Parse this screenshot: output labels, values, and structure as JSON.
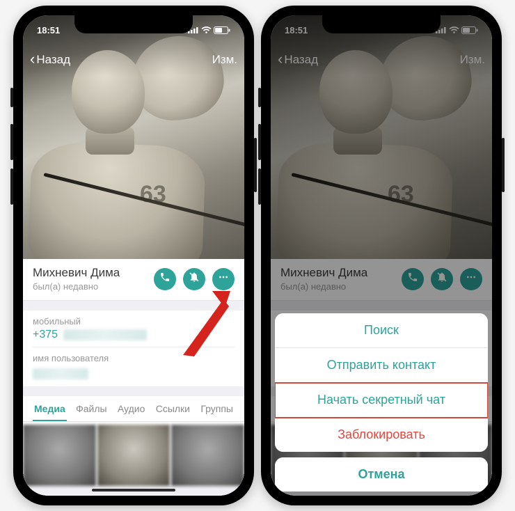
{
  "status": {
    "time": "18:51"
  },
  "nav": {
    "back": "Назад",
    "edit": "Изм."
  },
  "profile": {
    "name": "Михневич Дима",
    "status": "был(а) недавно",
    "shirt_number": "63"
  },
  "fields": {
    "phone_label": "мобильный",
    "phone_value": "+375",
    "username_label": "имя пользователя"
  },
  "tabs": {
    "media": "Медиа",
    "files": "Файлы",
    "audio": "Аудио",
    "links": "Ссылки",
    "groups": "Группы"
  },
  "sheet": {
    "search": "Поиск",
    "send_contact": "Отправить контакт",
    "secret_chat": "Начать секретный чат",
    "block": "Заблокировать",
    "cancel": "Отмена"
  }
}
